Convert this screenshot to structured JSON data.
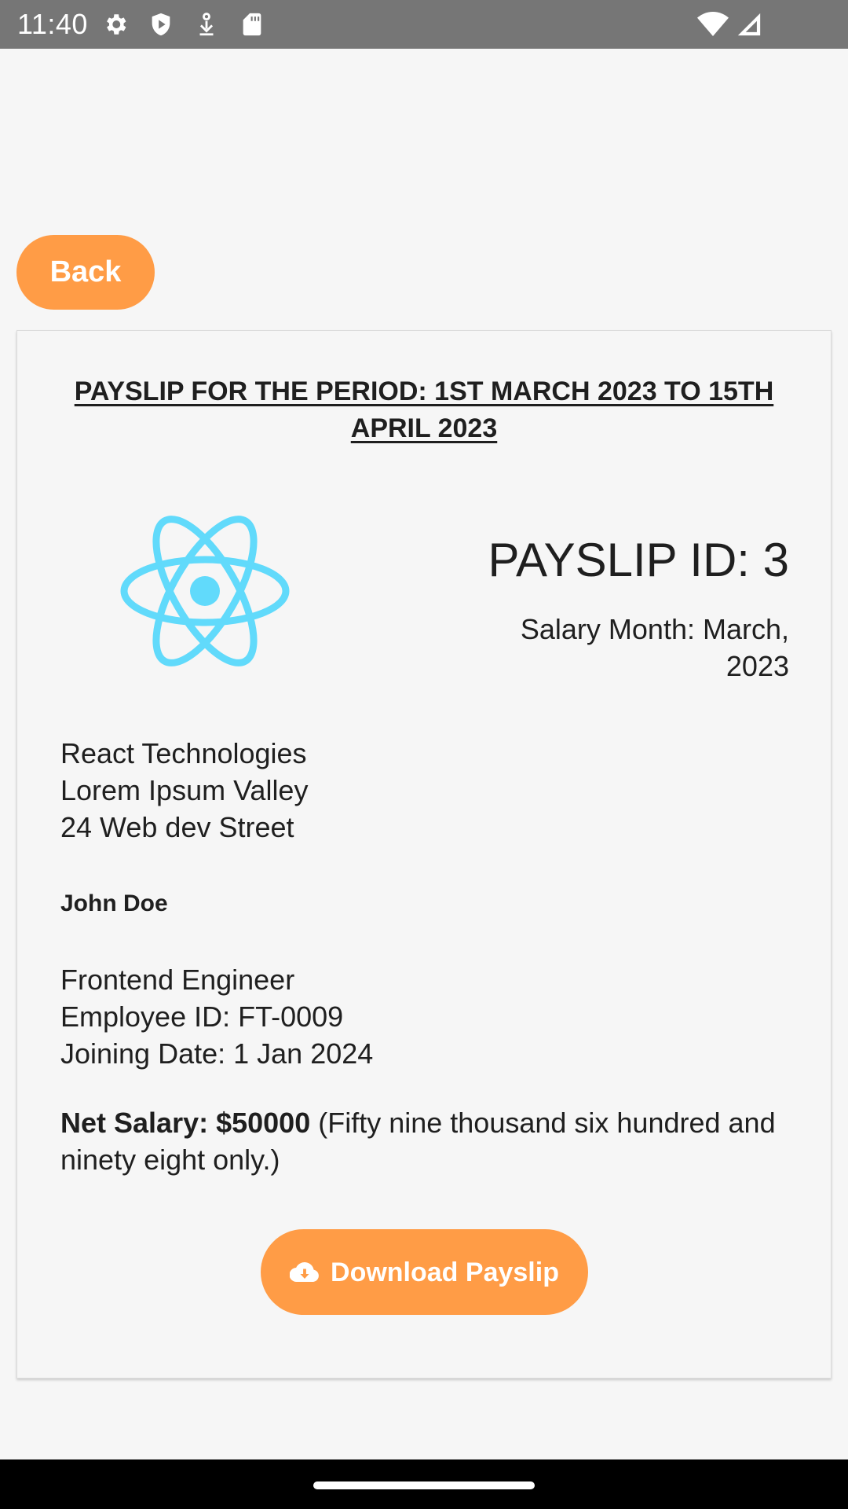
{
  "status_bar": {
    "time": "11:40",
    "icons": [
      "settings-icon",
      "shield-icon",
      "download-status-icon",
      "sd-card-icon",
      "wifi-icon",
      "signal-icon"
    ]
  },
  "back_button": {
    "label": "Back"
  },
  "payslip": {
    "period_title": "PAYSLIP FOR THE PERIOD: 1ST MARCH 2023 TO 15TH APRIL 2023",
    "logo": "react-logo-icon",
    "id_text": "PAYSLIP ID: 3",
    "salary_month": "Salary Month: March, 2023",
    "company": {
      "name": "React Technologies",
      "address_line1": "Lorem Ipsum Valley",
      "address_line2": "24 Web dev Street"
    },
    "employee": {
      "name": "John Doe",
      "designation": "Frontend Engineer",
      "employee_id": "Employee ID: FT-0009",
      "joining_date": "Joining Date: 1 Jan 2024"
    },
    "net_salary": {
      "label": "Net Salary: $50000",
      "in_words": "(Fifty nine thousand six hundred and ninety eight only.)"
    },
    "download_button": {
      "label": "Download Payslip",
      "icon": "cloud-download-icon"
    }
  },
  "colors": {
    "accent": "#ff9c46",
    "react_logo": "#61dafb",
    "status_bar": "#767676",
    "background": "#f6f6f6"
  }
}
